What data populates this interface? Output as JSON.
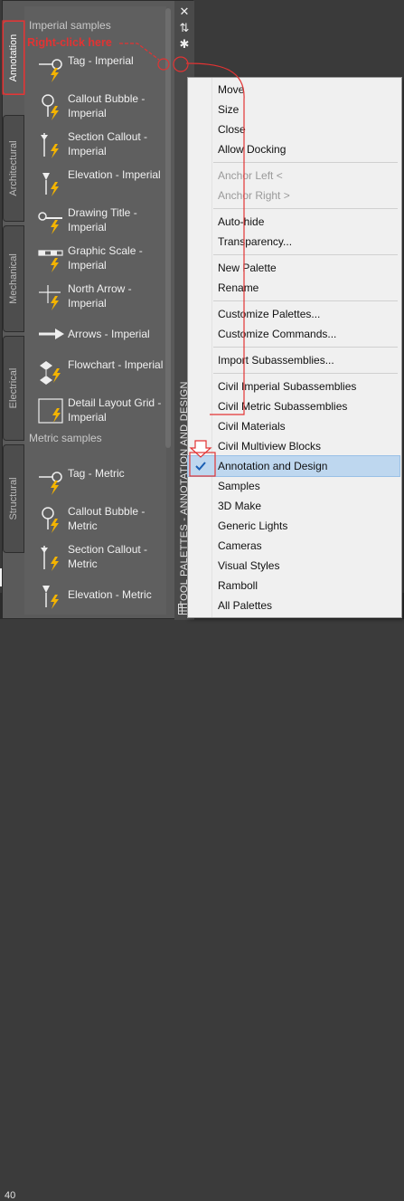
{
  "status_bar": {
    "number": "40"
  },
  "palette": {
    "tabs": [
      {
        "label": "Annotation",
        "active": true
      },
      {
        "label": "Architectural",
        "active": false
      },
      {
        "label": "Mechanical",
        "active": false
      },
      {
        "label": "Electrical",
        "active": false
      },
      {
        "label": "Structural",
        "active": false
      }
    ],
    "sections": [
      {
        "title": "Imperial samples"
      },
      {
        "title": "Metric samples"
      }
    ],
    "imperial_items": [
      {
        "label": "Tag - Imperial",
        "icon": "tag-icon"
      },
      {
        "label": "Callout Bubble - Imperial",
        "icon": "callout-bubble-icon"
      },
      {
        "label": "Section Callout - Imperial",
        "icon": "section-callout-icon"
      },
      {
        "label": "Elevation - Imperial",
        "icon": "elevation-icon"
      },
      {
        "label": "Drawing Title - Imperial",
        "icon": "drawing-title-icon"
      },
      {
        "label": "Graphic Scale - Imperial",
        "icon": "graphic-scale-icon"
      },
      {
        "label": "North Arrow - Imperial",
        "icon": "north-arrow-icon"
      },
      {
        "label": "Arrows - Imperial",
        "icon": "arrow-icon"
      },
      {
        "label": "Flowchart - Imperial",
        "icon": "flowchart-icon"
      },
      {
        "label": "Detail Layout Grid - Imperial",
        "icon": "grid-icon"
      }
    ],
    "metric_items": [
      {
        "label": "Tag - Metric",
        "icon": "tag-icon"
      },
      {
        "label": "Callout Bubble - Metric",
        "icon": "callout-bubble-icon"
      },
      {
        "label": "Section Callout - Metric",
        "icon": "section-callout-icon"
      },
      {
        "label": "Elevation - Metric",
        "icon": "elevation-icon"
      }
    ],
    "title": "TOOL PALETTES - ANNOTATION AND DESIGN",
    "controls": {
      "close": "✕",
      "autohide": "⇅",
      "properties": "✱"
    }
  },
  "annotation": {
    "text": "Right-click here",
    "color": "#e23333"
  },
  "context_menu": {
    "items": [
      {
        "label": "Move"
      },
      {
        "label": "Size"
      },
      {
        "label": "Close"
      },
      {
        "label": "Allow Docking"
      },
      {
        "label": "Anchor Left  <",
        "disabled": true
      },
      {
        "label": "Anchor Right  >",
        "disabled": true
      },
      {
        "label": "Auto-hide"
      },
      {
        "label": "Transparency..."
      },
      {
        "label": "New Palette"
      },
      {
        "label": "Rename"
      },
      {
        "label": "Customize Palettes..."
      },
      {
        "label": "Customize Commands..."
      },
      {
        "label": "Import Subassemblies..."
      },
      {
        "label": "Civil Imperial Subassemblies"
      },
      {
        "label": "Civil Metric Subassemblies"
      },
      {
        "label": "Civil Materials"
      },
      {
        "label": "Civil Multiview Blocks"
      },
      {
        "label": "Annotation and Design",
        "checked": true
      },
      {
        "label": "Samples"
      },
      {
        "label": "3D Make"
      },
      {
        "label": "Generic Lights"
      },
      {
        "label": "Cameras"
      },
      {
        "label": "Visual Styles"
      },
      {
        "label": "Ramboll"
      },
      {
        "label": "All Palettes"
      }
    ]
  },
  "colors": {
    "accent_red": "#e23333",
    "menu_highlight": "#bed7ef",
    "bolt_yellow": "#f4b400"
  }
}
